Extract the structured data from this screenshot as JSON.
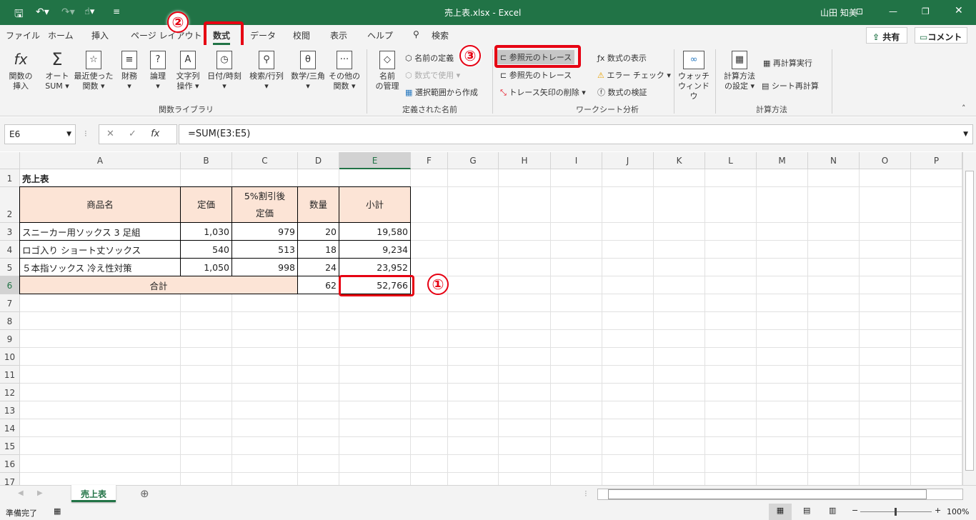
{
  "title": {
    "file": "売上表.xlsx  -  Excel",
    "user": "山田 知美"
  },
  "tabs": [
    "ファイル",
    "ホーム",
    "挿入",
    "ページ レイアウト",
    "数式",
    "データ",
    "校閲",
    "表示",
    "ヘルプ",
    "検索"
  ],
  "active_tab": "数式",
  "share": "共有",
  "comment": "コメント",
  "ribbon": {
    "library": [
      {
        "icon": "fx",
        "l1": "関数の",
        "l2": "挿入"
      },
      {
        "icon": "Σ",
        "l1": "オート",
        "l2": "SUM ▾"
      },
      {
        "icon": "☆",
        "l1": "最近使った",
        "l2": "関数 ▾"
      },
      {
        "icon": "≡",
        "l1": "財務",
        "l2": "▾"
      },
      {
        "icon": "?",
        "l1": "論理",
        "l2": "▾"
      },
      {
        "icon": "A",
        "l1": "文字列",
        "l2": "操作 ▾"
      },
      {
        "icon": "◷",
        "l1": "日付/時刻",
        "l2": "▾"
      },
      {
        "icon": "⚲",
        "l1": "検索/行列",
        "l2": "▾"
      },
      {
        "icon": "θ",
        "l1": "数学/三角",
        "l2": "▾"
      },
      {
        "icon": "···",
        "l1": "その他の",
        "l2": "関数 ▾"
      }
    ],
    "library_group": "関数ライブラリ",
    "names": {
      "manager1": "名前",
      "manager2": "の管理",
      "define": "名前の定義",
      "use": "数式で使用",
      "create": "選択範囲から作成",
      "group": "定義された名前"
    },
    "audit": {
      "precedents": "参照元のトレース",
      "dependents": "参照先のトレース",
      "remove": "トレース矢印の削除",
      "show": "数式の表示",
      "error": "エラー チェック",
      "evaluate": "数式の検証",
      "watch1": "ウォッチ",
      "watch2": "ウィンドウ",
      "group": "ワークシート分析"
    },
    "calc": {
      "options1": "計算方法",
      "options2": "の設定 ▾",
      "now": "再計算実行",
      "sheet": "シート再計算",
      "group": "計算方法"
    }
  },
  "formula_bar": {
    "name_box": "E6",
    "formula": "=SUM(E3:E5)"
  },
  "columns": [
    "A",
    "B",
    "C",
    "D",
    "E",
    "F",
    "G",
    "H",
    "I",
    "J",
    "K",
    "L",
    "M",
    "N",
    "O",
    "P"
  ],
  "rows": [
    "1",
    "2",
    "3",
    "4",
    "5",
    "6",
    "7",
    "8",
    "9",
    "10",
    "11",
    "12",
    "13",
    "14",
    "15",
    "16",
    "17"
  ],
  "sheet": {
    "title": "売上表",
    "headers": [
      "商品名",
      "定価",
      "5%割引後\n定価",
      "数量",
      "小計"
    ],
    "data": [
      [
        "スニーカー用ソックス 3 足組",
        "1,030",
        "979",
        "20",
        "19,580"
      ],
      [
        "ロゴ入り ショート丈ソックス",
        "540",
        "513",
        "18",
        "9,234"
      ],
      [
        "５本指ソックス 冷え性対策",
        "1,050",
        "998",
        "24",
        "23,952"
      ]
    ],
    "total": {
      "label": "合計",
      "qty": "62",
      "sum": "52,766"
    }
  },
  "sheet_tab": "売上表",
  "status": {
    "ready": "準備完了",
    "zoom": "100%"
  },
  "markers": [
    "①",
    "②",
    "③"
  ],
  "colors": {
    "accent": "#217346",
    "header_fill": "#fce4d6",
    "highlight": "#e60012"
  }
}
